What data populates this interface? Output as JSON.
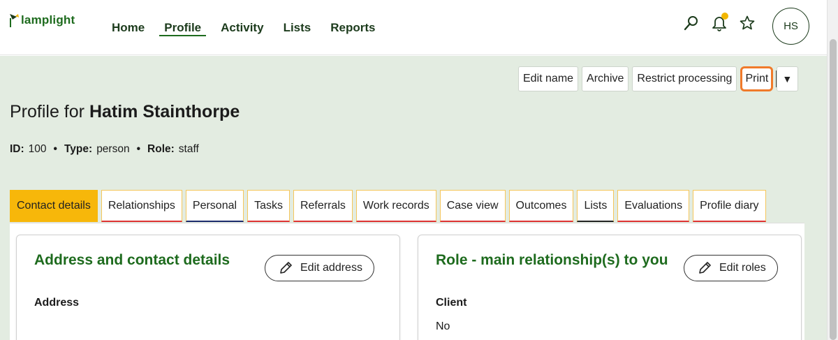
{
  "brand": {
    "name": "lamplight"
  },
  "nav": {
    "items": [
      {
        "label": "Home"
      },
      {
        "label": "Profile"
      },
      {
        "label": "Activity"
      },
      {
        "label": "Lists"
      },
      {
        "label": "Reports"
      }
    ],
    "active": "Profile"
  },
  "top_icons": [
    "search-icon",
    "bell-icon",
    "star-icon"
  ],
  "user": {
    "initials": "HS"
  },
  "actions": {
    "edit_name": "Edit name",
    "archive": "Archive",
    "restrict": "Restrict processing",
    "print": "Print",
    "dropdown": "▼"
  },
  "profile": {
    "title_prefix": "Profile for",
    "name": "Hatim Stainthorpe",
    "id_label": "ID:",
    "id_value": "100",
    "type_label": "Type:",
    "type_value": "person",
    "role_label": "Role:",
    "role_value": "staff",
    "separator": "•"
  },
  "tabs": [
    {
      "label": "Contact details"
    },
    {
      "label": "Relationships"
    },
    {
      "label": "Personal"
    },
    {
      "label": "Tasks"
    },
    {
      "label": "Referrals"
    },
    {
      "label": "Work records"
    },
    {
      "label": "Case view"
    },
    {
      "label": "Outcomes"
    },
    {
      "label": "Lists"
    },
    {
      "label": "Evaluations"
    },
    {
      "label": "Profile diary"
    }
  ],
  "cards": {
    "address": {
      "title": "Address and contact details",
      "button": "Edit address",
      "label": "Address"
    },
    "role": {
      "title": "Role - main relationship(s) to you",
      "button": "Edit roles",
      "label": "Client",
      "value": "No"
    }
  },
  "colors": {
    "brand_green": "#1e6b1e",
    "header_bg": "#e3ece1",
    "active_tab": "#f7b70a",
    "focus_orange": "#f07a2a",
    "notification": "#f2b600"
  }
}
